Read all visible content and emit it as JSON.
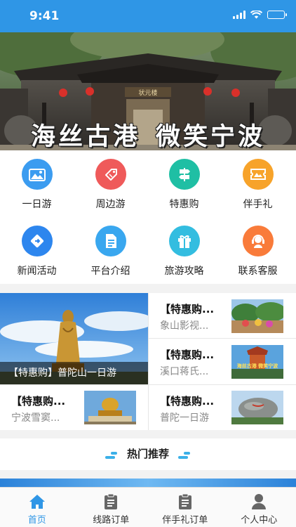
{
  "status_bar": {
    "time": "9:41"
  },
  "banner": {
    "title_left": "海丝古港",
    "title_right": "微笑宁波",
    "gate_plaque": "状元楼"
  },
  "menu": [
    {
      "label": "一日游",
      "icon": "landscape-icon",
      "color": "#3b9cf0"
    },
    {
      "label": "周边游",
      "icon": "ticket-tag-icon",
      "color": "#ef5a5a"
    },
    {
      "label": "特惠购",
      "icon": "signpost-icon",
      "color": "#1fbfa4"
    },
    {
      "label": "伴手礼",
      "icon": "ticket-icon",
      "color": "#f7a32a"
    },
    {
      "label": "新闻活动",
      "icon": "diamond-arrow-icon",
      "color": "#2d86ee"
    },
    {
      "label": "平台介绍",
      "icon": "document-icon",
      "color": "#39a7ef"
    },
    {
      "label": "旅游攻略",
      "icon": "gift-icon",
      "color": "#33bde0"
    },
    {
      "label": "联系客服",
      "icon": "headset-icon",
      "color": "#f97b3a"
    }
  ],
  "promo": {
    "big_caption": "【特惠购】普陀山一日游",
    "cells": [
      {
        "title": "【特惠购...",
        "subtitle": "象山影视..."
      },
      {
        "title": "【特惠购...",
        "subtitle": "溪口蒋氏..."
      },
      {
        "title": "【特惠购...",
        "subtitle": "宁波雪窦..."
      },
      {
        "title": "【特惠购...",
        "subtitle": "普陀一日游"
      }
    ],
    "badge_text": "海丝古港 微笑宁波"
  },
  "hot": {
    "label": "热门推荐"
  },
  "tabbar": [
    {
      "label": "首页",
      "icon": "home-icon",
      "active": true
    },
    {
      "label": "线路订单",
      "icon": "clipboard-icon",
      "active": false
    },
    {
      "label": "伴手礼订单",
      "icon": "clipboard-icon",
      "active": false
    },
    {
      "label": "个人中心",
      "icon": "person-icon",
      "active": false
    }
  ],
  "colors": {
    "accent": "#2f96e6"
  }
}
